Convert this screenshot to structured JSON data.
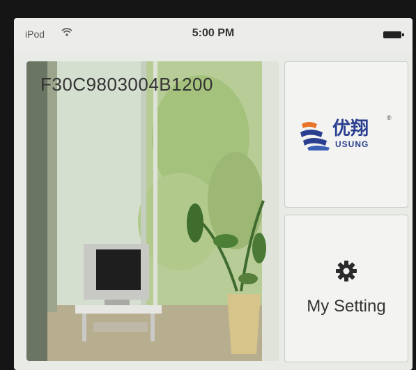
{
  "status_bar": {
    "carrier": "iPod",
    "wifi_icon": "wifi-icon",
    "time": "5:00 PM",
    "battery_icon": "battery-full-icon"
  },
  "camera": {
    "id_label": "F30C9803004B1200"
  },
  "logo": {
    "chinese": "优翔",
    "english": "USUNG",
    "registered": "®",
    "colors": {
      "blue": "#2a3f8f",
      "orange": "#e8752a"
    }
  },
  "setting_tile": {
    "icon": "gear-icon",
    "label": "My Setting"
  },
  "colors": {
    "screen_bg": "#e9ebe7",
    "tile_bg": "#f3f4f1",
    "text": "#333333"
  }
}
